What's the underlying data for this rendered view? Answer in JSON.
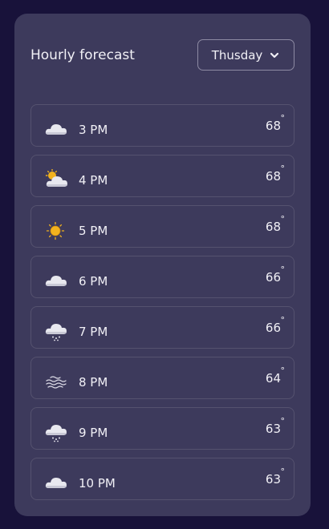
{
  "header": {
    "title": "Hourly forecast",
    "day_select": {
      "value": "Thusday"
    }
  },
  "forecast": [
    {
      "time": "3 PM",
      "temp": "68",
      "degree": "°",
      "icon": "cloud-icon"
    },
    {
      "time": "4 PM",
      "temp": "68",
      "degree": "°",
      "icon": "partly-sunny-icon"
    },
    {
      "time": "5 PM",
      "temp": "68",
      "degree": "°",
      "icon": "sun-icon"
    },
    {
      "time": "6 PM",
      "temp": "66",
      "degree": "°",
      "icon": "cloud-icon"
    },
    {
      "time": "7 PM",
      "temp": "66",
      "degree": "°",
      "icon": "cloud-snow-icon"
    },
    {
      "time": "8 PM",
      "temp": "64",
      "degree": "°",
      "icon": "fog-icon"
    },
    {
      "time": "9 PM",
      "temp": "63",
      "degree": "°",
      "icon": "cloud-snow-icon"
    },
    {
      "time": "10 PM",
      "temp": "63",
      "degree": "°",
      "icon": "cloud-icon"
    }
  ],
  "colors": {
    "page_bg": "#18123a",
    "card_bg": "#3d3a5c",
    "row_border": "#55526f",
    "text": "#f1f0f6",
    "sun": "#f2b21e"
  }
}
